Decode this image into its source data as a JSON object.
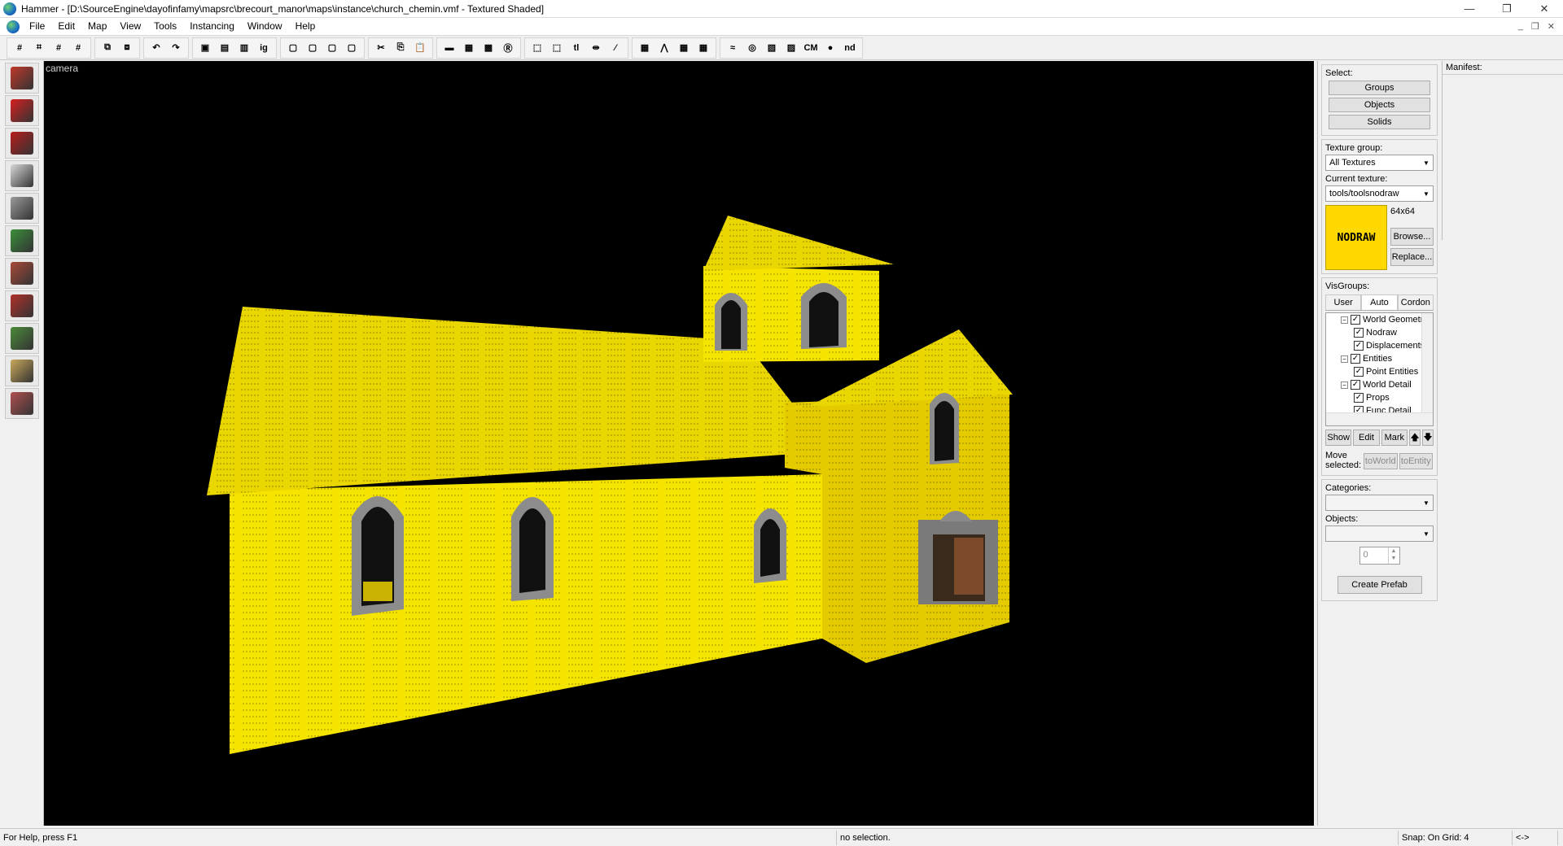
{
  "window": {
    "title": "Hammer - [D:\\SourceEngine\\dayofinfamy\\mapsrc\\brecourt_manor\\maps\\instance\\church_chemin.vmf - Textured Shaded]",
    "controls": {
      "minimize": "—",
      "restore": "❐",
      "close": "✕"
    }
  },
  "menubar": {
    "items": [
      "File",
      "Edit",
      "Map",
      "View",
      "Tools",
      "Instancing",
      "Window",
      "Help"
    ],
    "mdi": {
      "minimize": "_",
      "restore": "❐",
      "close": "✕"
    }
  },
  "toolbar": {
    "groups": [
      {
        "buttons": [
          {
            "icon": "grid-icon",
            "glyph": "#"
          },
          {
            "icon": "grid-dot-icon",
            "glyph": "⌗"
          },
          {
            "icon": "grid-smaller-icon",
            "glyph": "#"
          },
          {
            "icon": "grid-larger-icon",
            "glyph": "#"
          }
        ]
      },
      {
        "buttons": [
          {
            "icon": "group-icon",
            "glyph": "⧉"
          },
          {
            "icon": "ungroup-icon",
            "glyph": "⧈"
          }
        ]
      },
      {
        "buttons": [
          {
            "icon": "undo-icon",
            "glyph": "↶"
          },
          {
            "icon": "redo-icon",
            "glyph": "↷"
          }
        ]
      },
      {
        "buttons": [
          {
            "icon": "carve-icon",
            "glyph": "▣"
          },
          {
            "icon": "hollow-icon",
            "glyph": "▤"
          },
          {
            "icon": "texture-lock-icon",
            "glyph": "▥"
          },
          {
            "icon": "ignore-groups-icon",
            "glyph": "ig"
          }
        ]
      },
      {
        "buttons": [
          {
            "icon": "hide-selected-icon",
            "glyph": "▢"
          },
          {
            "icon": "hide-unselected-icon",
            "glyph": "▢"
          },
          {
            "icon": "show-all-icon",
            "glyph": "▢"
          },
          {
            "icon": "edit-cordon-icon",
            "glyph": "▢"
          }
        ]
      },
      {
        "buttons": [
          {
            "icon": "cut-icon",
            "glyph": "✂"
          },
          {
            "icon": "copy-icon",
            "glyph": "⎘"
          },
          {
            "icon": "paste-icon",
            "glyph": "📋"
          }
        ]
      },
      {
        "buttons": [
          {
            "icon": "toggle-helpers-icon",
            "glyph": "▬"
          },
          {
            "icon": "toggle-3d-grid-icon",
            "glyph": "▦"
          },
          {
            "icon": "toggle-models-icon",
            "glyph": "▩"
          },
          {
            "icon": "toggle-radius-icon",
            "glyph": "Ⓡ"
          }
        ]
      },
      {
        "buttons": [
          {
            "icon": "select-bounds-icon",
            "glyph": "⬚"
          },
          {
            "icon": "select-by-handles-icon",
            "glyph": "⬚"
          },
          {
            "icon": "texture-lock-tl-icon",
            "glyph": "tl"
          },
          {
            "icon": "scale-lock-icon",
            "glyph": "⇹"
          },
          {
            "icon": "vertex-edit-icon",
            "glyph": "⁄"
          }
        ]
      },
      {
        "buttons": [
          {
            "icon": "toggle-displacement-icon",
            "glyph": "▦"
          },
          {
            "icon": "toggle-autovis-icon",
            "glyph": "⋀"
          },
          {
            "icon": "toggle-skip-icon",
            "glyph": "▦"
          },
          {
            "icon": "toggle-hint-icon",
            "glyph": "▦"
          }
        ]
      },
      {
        "buttons": [
          {
            "icon": "smooth-icon",
            "glyph": "≈"
          },
          {
            "icon": "compile-icon",
            "glyph": "◎"
          },
          {
            "icon": "entity-report-icon",
            "glyph": "▧"
          },
          {
            "icon": "check-problems-icon",
            "glyph": "▨"
          },
          {
            "icon": "cubemap-icon",
            "glyph": "CM"
          },
          {
            "icon": "run-map-icon",
            "glyph": "●"
          },
          {
            "icon": "nodraw-icon",
            "glyph": "nd"
          }
        ]
      }
    ]
  },
  "tools": [
    {
      "name": "selection-tool",
      "color": "#c0392b"
    },
    {
      "name": "magnify-tool",
      "color": "#d62020"
    },
    {
      "name": "camera-tool",
      "color": "#b81d1d"
    },
    {
      "name": "entity-tool",
      "color": "#d8d8d8"
    },
    {
      "name": "block-tool",
      "color": "#9a9a9a"
    },
    {
      "name": "texture-application-tool",
      "color": "#3b8f3b"
    },
    {
      "name": "apply-current-texture-tool",
      "color": "#a84a3a"
    },
    {
      "name": "decal-tool",
      "color": "#b0302a"
    },
    {
      "name": "overlay-tool",
      "color": "#4c8a3a"
    },
    {
      "name": "clipping-tool",
      "color": "#c9a85a"
    },
    {
      "name": "vertex-tool",
      "color": "#b05050"
    }
  ],
  "viewport": {
    "label": "camera",
    "colors": {
      "background": "#000000",
      "wall": "#f5e400",
      "wall_dark": "#e3cb00",
      "stone": "#9a9a9a"
    }
  },
  "rightpanel": {
    "select": {
      "label": "Select:",
      "buttons": [
        "Groups",
        "Objects",
        "Solids"
      ]
    },
    "texture": {
      "group_label": "Texture group:",
      "group_value": "All Textures",
      "current_label": "Current texture:",
      "current_value": "tools/toolsnodraw",
      "swatch_text": "NODRAW",
      "size": "64x64",
      "browse_label": "Browse...",
      "replace_label": "Replace..."
    },
    "visgroups": {
      "label": "VisGroups:",
      "tabs": [
        "User",
        "Auto",
        "Cordon"
      ],
      "active_tab": "Auto",
      "tree": [
        {
          "text": "World Geometry",
          "depth": 0,
          "expander": "−"
        },
        {
          "text": "Nodraw",
          "depth": 1
        },
        {
          "text": "Displacements",
          "depth": 1
        },
        {
          "text": "Entities",
          "depth": 0,
          "expander": "−"
        },
        {
          "text": "Point Entities",
          "depth": 1
        },
        {
          "text": "World Detail",
          "depth": 0,
          "expander": "−"
        },
        {
          "text": "Props",
          "depth": 1
        },
        {
          "text": "Func Detail",
          "depth": 1
        }
      ],
      "show_label": "Show",
      "edit_label": "Edit",
      "mark_label": "Mark",
      "up_glyph": "🡅",
      "down_glyph": "🡇"
    },
    "move": {
      "label": "Move selected:",
      "to_world": "toWorld",
      "to_entity": "toEntity"
    },
    "prefab": {
      "categories_label": "Categories:",
      "objects_label": "Objects:",
      "spinner_value": "0",
      "create_label": "Create Prefab"
    }
  },
  "manifest": {
    "label": "Manifest:"
  },
  "statusbar": {
    "help": "For Help, press F1",
    "selection": "no selection.",
    "snap": "Snap: On Grid: 4",
    "extra": "<->"
  }
}
